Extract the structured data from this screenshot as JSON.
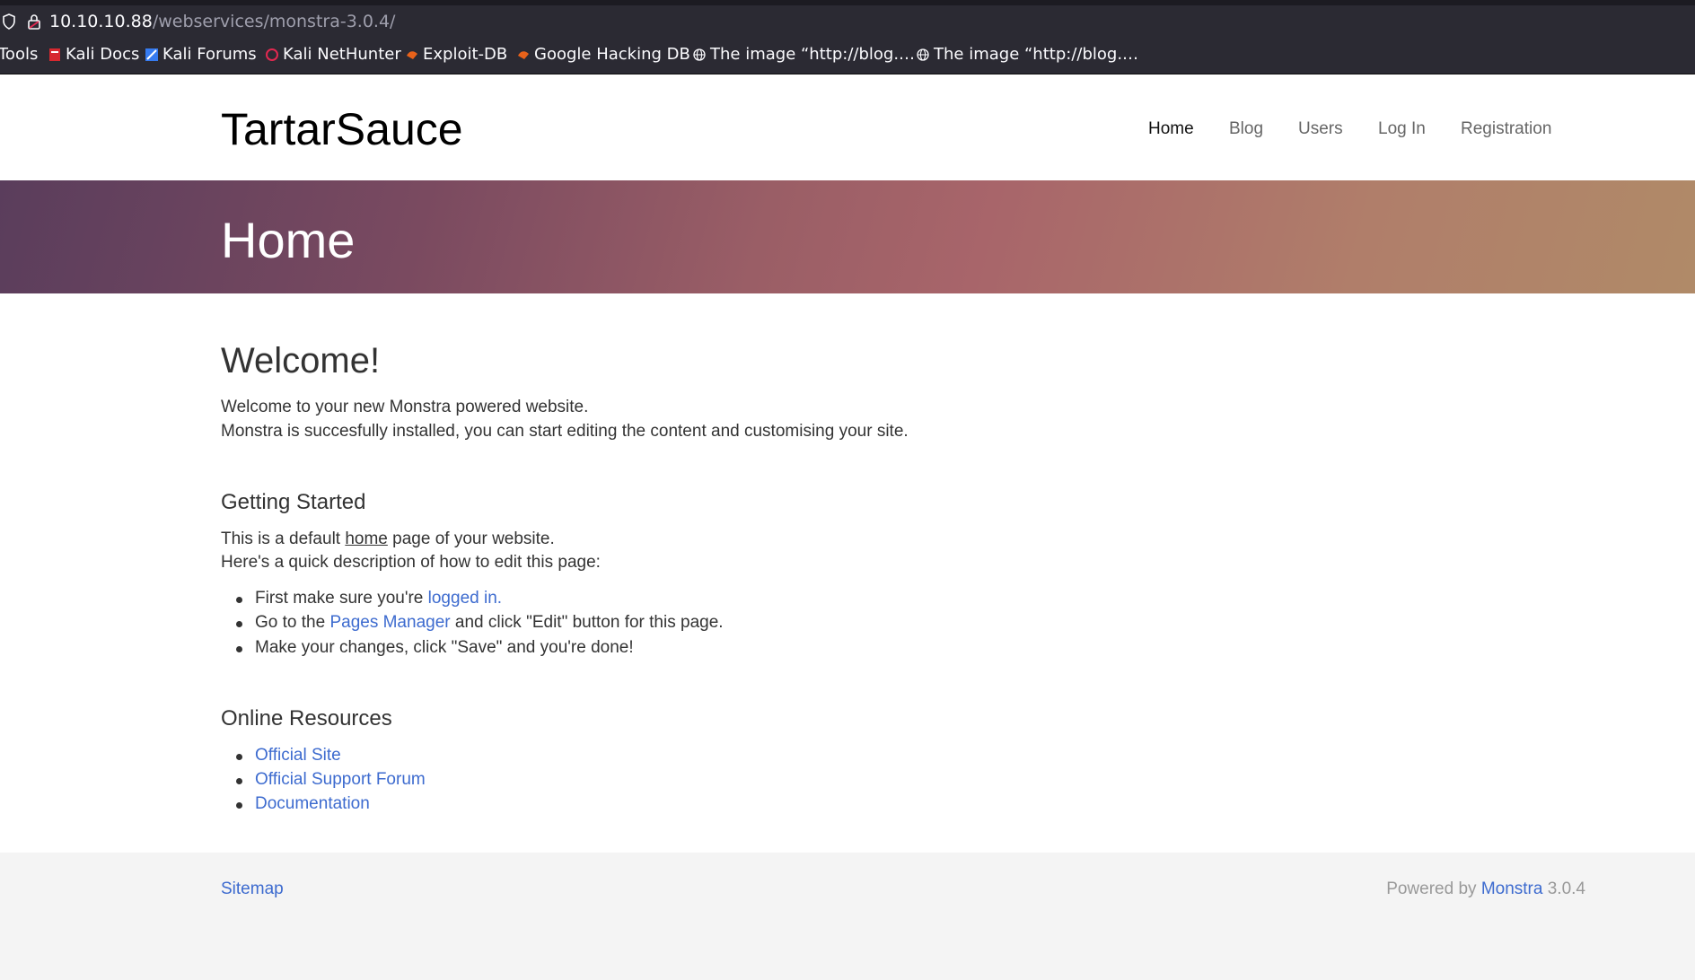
{
  "browser": {
    "url_host": "10.10.10.88",
    "url_path": "/webservices/monstra-3.0.4/",
    "bookmarks": [
      {
        "label": "Tools",
        "icon": "none"
      },
      {
        "label": "Kali Docs",
        "icon": "kali-docs-icon"
      },
      {
        "label": "Kali Forums",
        "icon": "kali-forums-icon"
      },
      {
        "label": "Kali NetHunter",
        "icon": "nethunter-icon"
      },
      {
        "label": "Exploit-DB",
        "icon": "exploit-db-icon"
      },
      {
        "label": "Google Hacking DB",
        "icon": "ghdb-icon"
      },
      {
        "label": "The image “http://blog.…",
        "icon": "globe-icon"
      },
      {
        "label": "The image “http://blog.…",
        "icon": "globe-icon"
      }
    ]
  },
  "site": {
    "brand": "TartarSauce",
    "nav": [
      "Home",
      "Blog",
      "Users",
      "Log In",
      "Registration"
    ],
    "active_nav": "Home"
  },
  "hero": {
    "title": "Home"
  },
  "content": {
    "welcome_heading": "Welcome!",
    "welcome_line1": "Welcome to your new Monstra powered website.",
    "welcome_line2": "Monstra is succesfully installed, you can start editing the content and customising your site.",
    "getting_started_heading": "Getting Started",
    "gs_line1_pre": "This is a default ",
    "gs_line1_link": "home",
    "gs_line1_post": " page of your website.",
    "gs_line2": "Here's a quick description of how to edit this page:",
    "step1_pre": "First make sure you're ",
    "step1_link": "logged in.",
    "step2_pre": "Go to the ",
    "step2_link": "Pages Manager",
    "step2_post": " and click \"Edit\" button for this page.",
    "step3": "Make your changes, click \"Save\" and you're done!",
    "resources_heading": "Online Resources",
    "resources": [
      "Official Site",
      "Official Support Forum",
      "Documentation"
    ]
  },
  "footer": {
    "sitemap": "Sitemap",
    "powered_pre": "Powered by ",
    "powered_link": "Monstra",
    "powered_version": " 3.0.4"
  },
  "colors": {
    "link": "#3d6bcf",
    "text": "#333333",
    "browser_bg": "#2b2a33",
    "footer_bg": "#f4f4f4"
  }
}
